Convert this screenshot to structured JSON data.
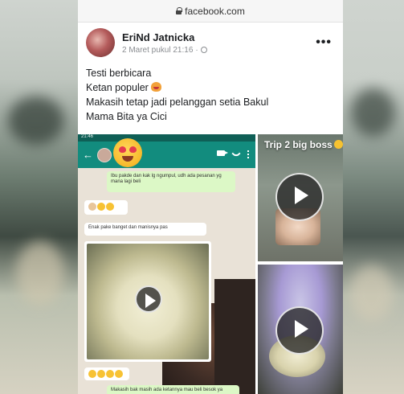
{
  "browser": {
    "url": "facebook.com"
  },
  "post": {
    "author": "EriNd Jatnicka",
    "timestamp": "2 Maret pukul 21:16",
    "lines": [
      "Testi berbicara",
      "Ketan populer",
      "Makasih tetap jadi pelanggan setia Bakul",
      "Mama Bita ya Cici"
    ]
  },
  "media": {
    "chat": {
      "status_time": "21:46",
      "messages": [
        "Ibu pakde dan kak lg ngumpul, udh ada pesanan yg mana lagi beli",
        "Enak pake banget dan manisnya pas",
        "Makasih bak masih ada ketannya mau beli besok ya"
      ]
    },
    "right_caption": "Trip 2 big boss"
  },
  "colors": {
    "whatsapp_header": "#128c7e",
    "outgoing_bubble": "#dcf8c6",
    "chat_background": "#e9e2d7",
    "facebook_text": "#1c1e21",
    "meta_gray": "#8a8d91"
  }
}
